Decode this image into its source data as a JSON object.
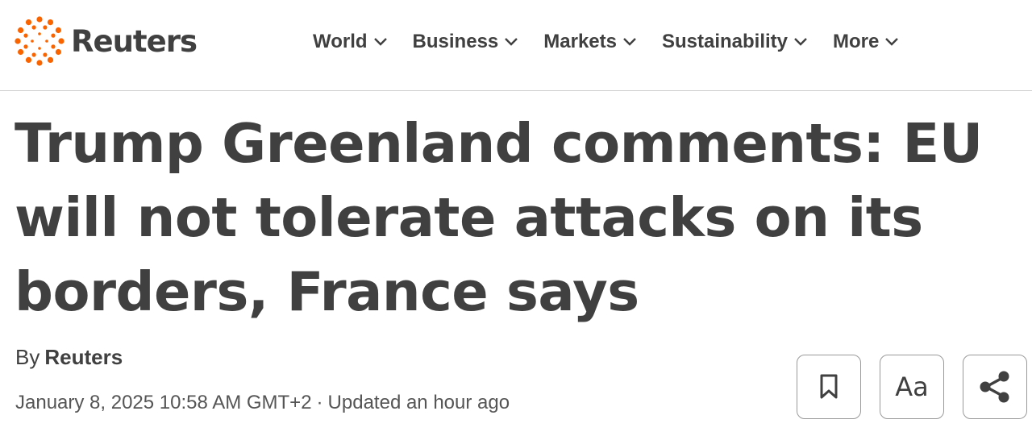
{
  "brand": {
    "name": "Reuters",
    "accent": "#fa6400"
  },
  "nav": {
    "items": [
      {
        "label": "World"
      },
      {
        "label": "Business"
      },
      {
        "label": "Markets"
      },
      {
        "label": "Sustainability"
      },
      {
        "label": "More"
      }
    ]
  },
  "article": {
    "headline": "Trump Greenland comments: EU will not tolerate attacks on its borders, France says",
    "byline_prefix": "By",
    "author": "Reuters",
    "published": "January 8, 2025 10:58 AM GMT+2",
    "separator": "·",
    "updated": "Updated an hour ago"
  },
  "tools": {
    "bookmark_icon": "bookmark-icon",
    "text_size_label": "Aa",
    "share_icon": "share-icon"
  }
}
